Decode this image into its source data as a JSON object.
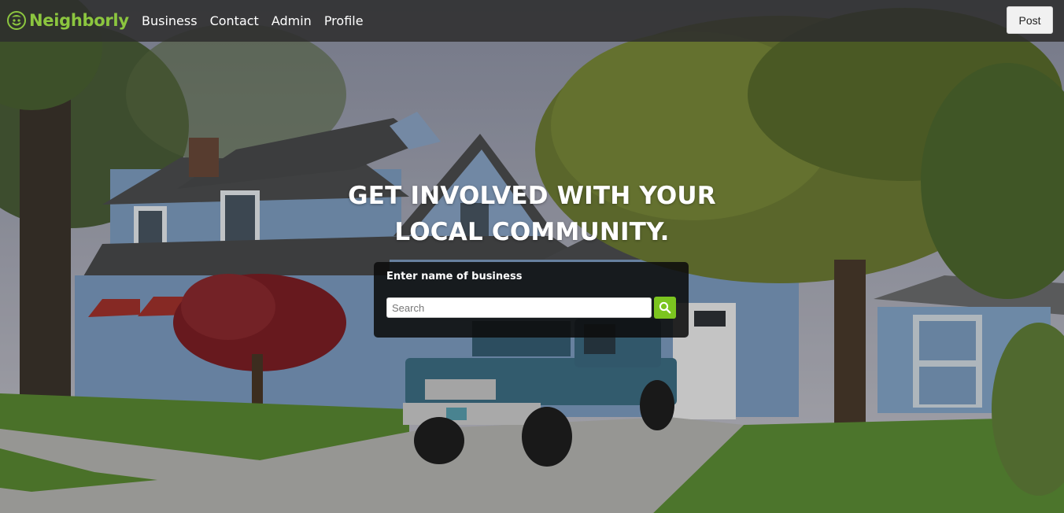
{
  "navbar": {
    "brand_name": "Neighborly",
    "brand_icon": "leaf-face-logo",
    "links": [
      "Business",
      "Contact",
      "Admin",
      "Profile"
    ],
    "post_label": "Post"
  },
  "hero": {
    "headline_line1": "GET INVOLVED WITH YOUR",
    "headline_line2": "LOCAL COMMUNITY.",
    "background": "photo of a blue suburban house with a pickup truck and trees"
  },
  "search": {
    "label": "Enter name of business",
    "placeholder": "Search",
    "value": "",
    "button_icon": "search-icon"
  },
  "colors": {
    "brand": "#8cc63f",
    "accent_button": "#7cc520",
    "navbar_bg": "#2d2d2d"
  }
}
